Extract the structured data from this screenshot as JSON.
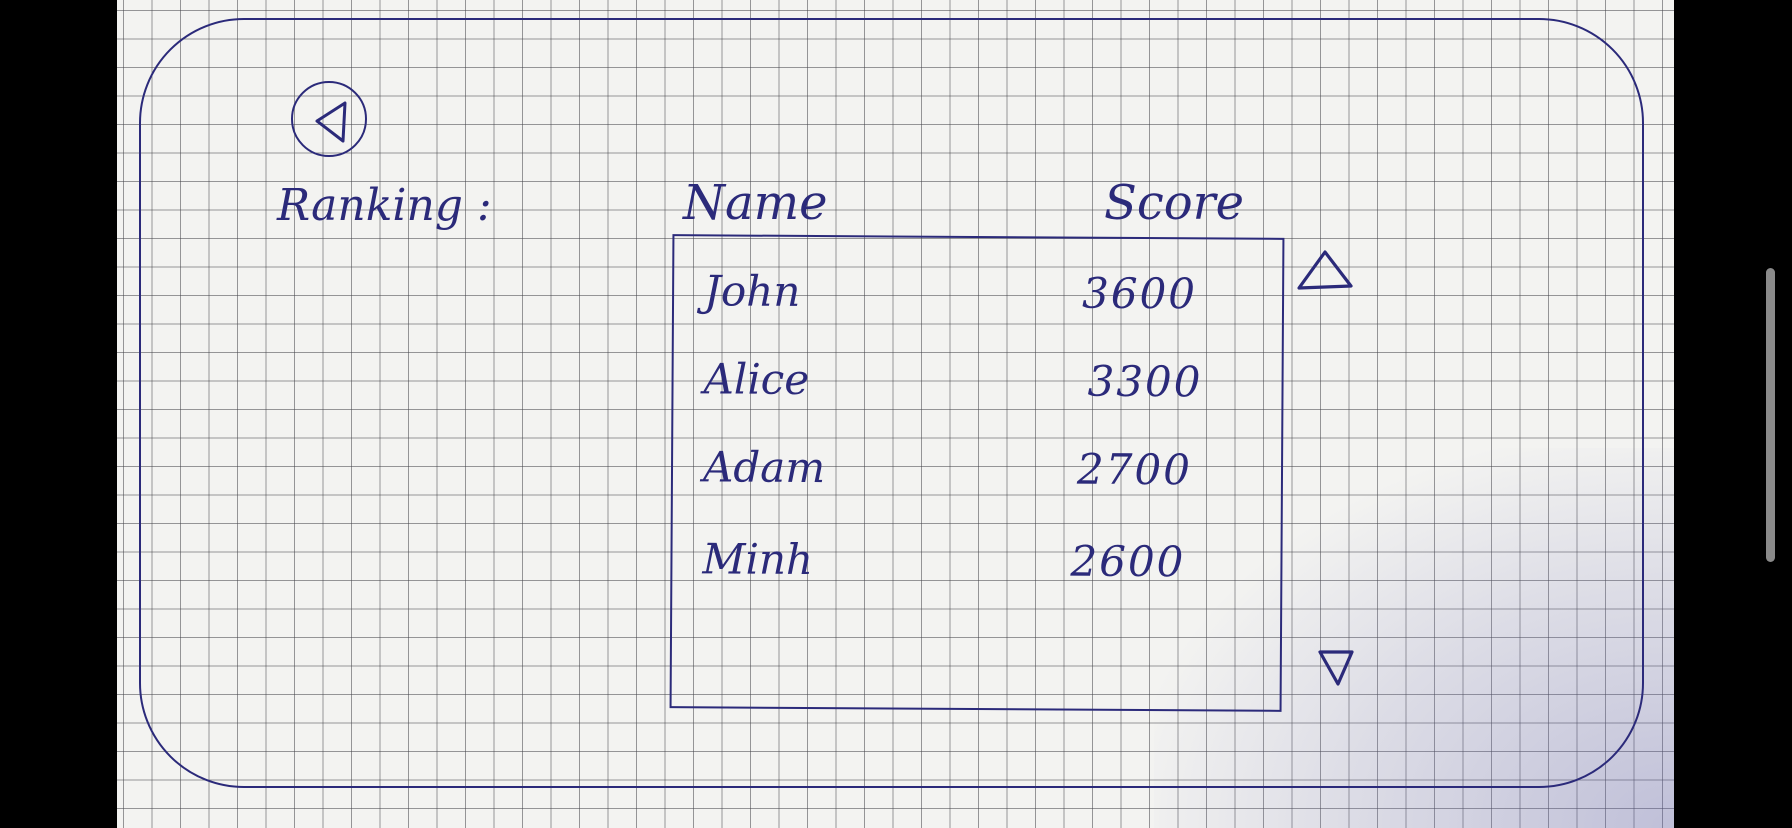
{
  "screen": {
    "title": "Ranking :",
    "back_icon": "left-triangle-in-circle-icon"
  },
  "ranking_table": {
    "headers": {
      "name": "Name",
      "score": "Score"
    },
    "rows": [
      {
        "name": "John",
        "score": "3600"
      },
      {
        "name": "Alice",
        "score": "3300"
      },
      {
        "name": "Adam",
        "score": "2700"
      },
      {
        "name": "Minh",
        "score": "2600"
      }
    ],
    "scroll_up_icon": "up-triangle-icon",
    "scroll_down_icon": "down-triangle-icon"
  },
  "colors": {
    "ink": "#2b2a7a",
    "paper": "#f3f3f1",
    "grid": "#46464b"
  }
}
